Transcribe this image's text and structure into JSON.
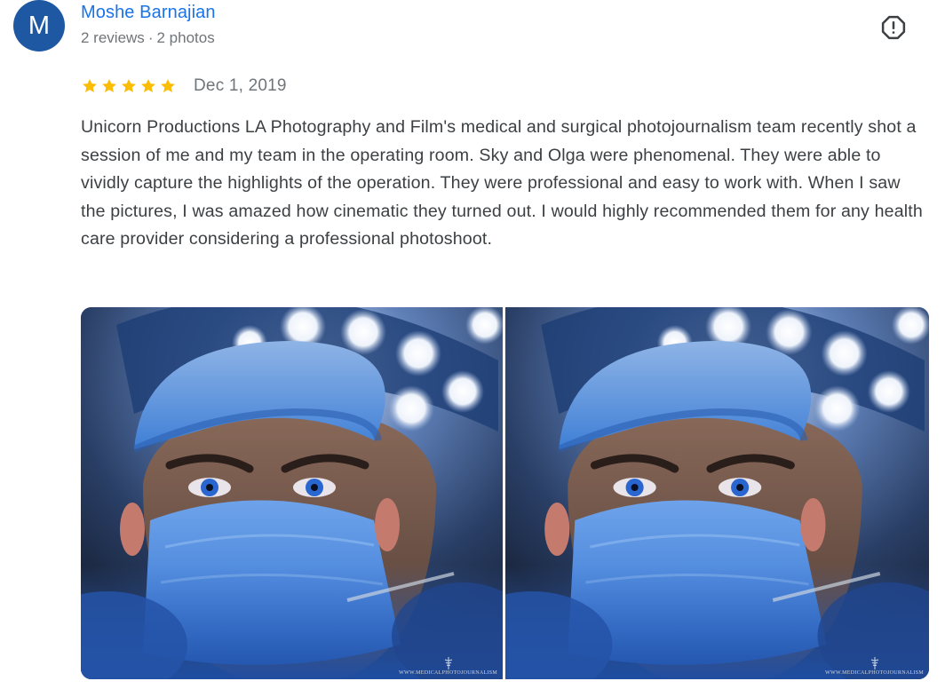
{
  "reviewer": {
    "initial": "M",
    "name": "Moshe Barnajian",
    "reviews": "2 reviews",
    "separator": "·",
    "photos": "2 photos",
    "avatar_color": "#1e58a3"
  },
  "flag": {
    "icon": "report-flag-icon"
  },
  "review": {
    "rating": 5,
    "max_rating": 5,
    "star_color": "#fbbc04",
    "date": "Dec 1, 2019",
    "text": "Unicorn Productions LA Photography and Film's medical and surgical photojournalism team recently shot a session of me and my team in the operating room. Sky and Olga were phenomenal. They were able to vividly capture the highlights of the operation. They were professional and easy to work with. When I saw the pictures, I was amazed how cinematic they turned out. I would highly recommended them for any health care provider considering a professional photoshoot."
  },
  "photos": [
    {
      "watermark": "WWW.MEDICALPHOTOJOURNALISM"
    },
    {
      "watermark": "WWW.MEDICALPHOTOJOURNALISM"
    }
  ],
  "colors": {
    "name_link": "#1a73e8",
    "meta_text": "#70757a",
    "body_text": "#3c4043"
  }
}
